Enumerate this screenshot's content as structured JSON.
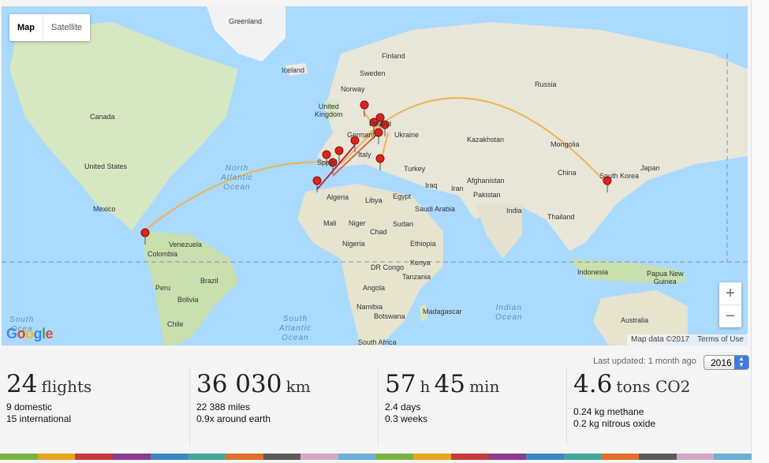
{
  "map": {
    "toggle": {
      "map": "Map",
      "satellite": "Satellite"
    },
    "zoom": {
      "in": "+",
      "out": "−"
    },
    "attribution": {
      "data": "Map data ©2017",
      "terms": "Terms of Use"
    },
    "logo": "Google",
    "labels": {
      "greenland": "Greenland",
      "iceland": "Iceland",
      "finland": "Finland",
      "sweden": "Sweden",
      "norway": "Norway",
      "russia": "Russia",
      "uk": "United\nKingdom",
      "canada": "Canada",
      "united_states": "United States",
      "mexico": "Mexico",
      "kazakhstan": "Kazakhstan",
      "mongolia": "Mongolia",
      "ukraine": "Ukraine",
      "turkey": "Turkey",
      "italy": "Italy",
      "spain": "Spain",
      "germany": "Germany",
      "poland": "Poland",
      "china": "China",
      "south_korea": "South Korea",
      "japan": "Japan",
      "iraq": "Iraq",
      "iran": "Iran",
      "afghanistan": "Afghanistan",
      "pakistan": "Pakistan",
      "india": "India",
      "thailand": "Thailand",
      "algeria": "Algeria",
      "libya": "Libya",
      "egypt": "Egypt",
      "saudi_arabia": "Saudi Arabia",
      "mali": "Mali",
      "niger": "Niger",
      "chad": "Chad",
      "sudan": "Sudan",
      "ethiopia": "Ethiopia",
      "nigeria": "Nigeria",
      "kenya": "Kenya",
      "dr_congo": "DR Congo",
      "tanzania": "Tanzania",
      "angola": "Angola",
      "namibia": "Namibia",
      "botswana": "Botswana",
      "madagascar": "Madagascar",
      "south_africa": "South Africa",
      "venezuela": "Venezuela",
      "colombia": "Colombia",
      "peru": "Peru",
      "brazil": "Brazil",
      "bolivia": "Bolivia",
      "chile": "Chile",
      "indonesia": "Indonesia",
      "papua_new_guinea": "Papua New\nGuinea",
      "australia": "Australia",
      "north_atlantic": "North\nAtlantic\nOcean",
      "south_atlantic": "South\nAtlantic\nOcean",
      "indian_ocean": "Indian\nOcean",
      "south_pacific": "South\nOcea"
    }
  },
  "header": {
    "last_updated": "Last updated: 1 month ago",
    "year": "2016"
  },
  "stats": {
    "flights": {
      "num": "24",
      "unit": "flights",
      "line1": "9 domestic",
      "line2": "15 international"
    },
    "distance": {
      "num": "36 030",
      "unit": "km",
      "line1": "22 388 miles",
      "line2": "0.9x around earth"
    },
    "time": {
      "num1": "57",
      "unit1": "h",
      "num2": "45",
      "unit2": "min",
      "line1": "2.4 days",
      "line2": "0.3 weeks"
    },
    "co2": {
      "num": "4.6",
      "unit": "tons CO2",
      "line1": "0.24 kg methane",
      "line2": "0.2 kg nitrous oxide"
    }
  },
  "colors": {
    "land": "#e8e6d9",
    "water": "#aadaff",
    "route_light": "#f0b45a",
    "route_dark": "#b5283a",
    "pin": "#d9261c",
    "stripe": [
      "#7ab33f",
      "#e5a61c",
      "#c73b3b",
      "#8b3e8e",
      "#3b87c4",
      "#3fa89b",
      "#e36e2b",
      "#5c5c5c",
      "#d6a6c8",
      "#68b0d8"
    ]
  }
}
